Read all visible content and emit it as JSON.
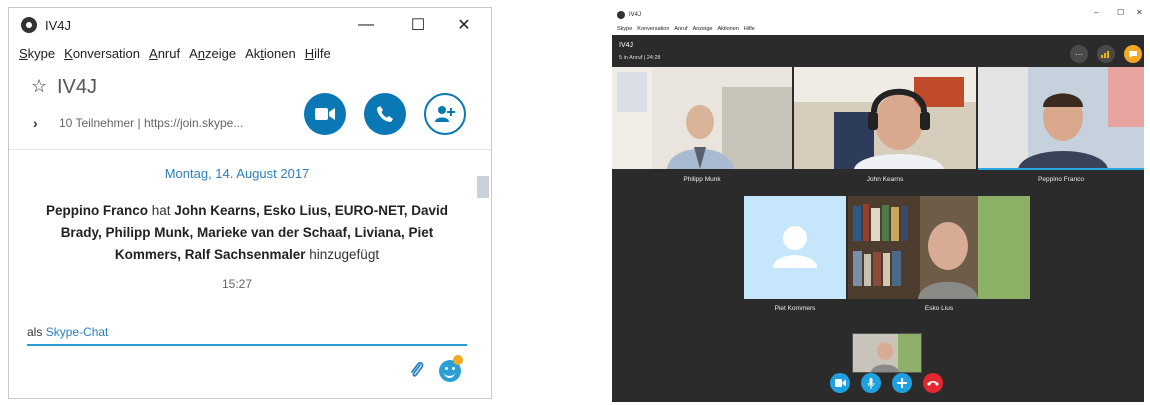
{
  "left_window": {
    "title": "IV4J",
    "controls": {
      "minimize": "—",
      "maximize": "☐",
      "close": "✕"
    },
    "menu": [
      {
        "label": "Skype",
        "acc": "S"
      },
      {
        "label": "Konversation",
        "acc": "K"
      },
      {
        "label": "Anruf",
        "acc": "A"
      },
      {
        "label": "Anzeige",
        "acc": "n"
      },
      {
        "label": "Aktionen",
        "acc": "t"
      },
      {
        "label": "Hilfe",
        "acc": "H"
      }
    ],
    "conversation_name": "IV4J",
    "participants_summary": "10 Teilnehmer | https://join.skype...",
    "date_separator": "Montag, 14. August 2017",
    "message": {
      "actor": "Peppino Franco",
      "verb": " hat ",
      "added": "John Kearns, Esko Lius, EURO-NET, David Brady, Philipp Munk, Marieke van der Schaaf, Liviana, Piet Kommers, Ralf Sachsenmaler",
      "suffix": " hinzugefügt"
    },
    "time": "15:27",
    "input_prefix": "als ",
    "input_link": "Skype-Chat",
    "accent_color": "#0a78b4"
  },
  "right_window": {
    "title": "IV4J",
    "menu": [
      "Skype",
      "Konversation",
      "Anruf",
      "Anzeige",
      "Aktionen",
      "Hilfe"
    ],
    "conversation_name": "IV4J",
    "call_status": "5 in Anruf | 24:28",
    "participants": [
      "Philipp Munk",
      "John Kearns",
      "Peppino Franco",
      "Piet Kommers",
      "Esko Lius"
    ],
    "call_buttons": [
      "video-icon",
      "mic-icon",
      "add-icon",
      "hangup-icon"
    ],
    "colors": {
      "button_blue": "#1fa0e0",
      "hangup_red": "#e3262f"
    }
  }
}
